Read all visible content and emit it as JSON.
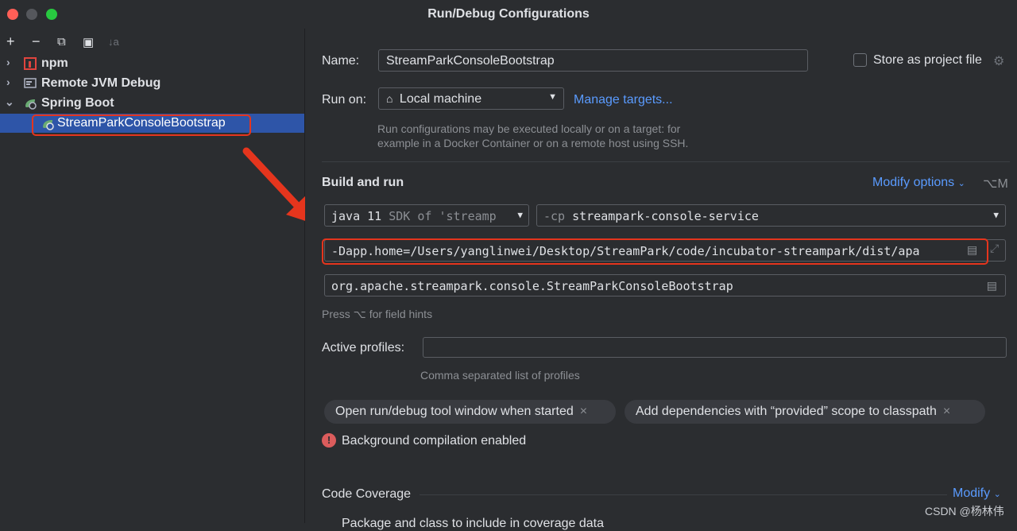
{
  "window": {
    "title": "Run/Debug Configurations"
  },
  "toolbar": {
    "add": "+",
    "remove": "−",
    "copy": "⧉",
    "folder": "▣",
    "sort": "↓a"
  },
  "tree": {
    "npm": "npm",
    "remote": "Remote JVM Debug",
    "spring": "Spring Boot",
    "selected": "StreamParkConsoleBootstrap"
  },
  "form": {
    "name_label": "Name:",
    "name_value": "StreamParkConsoleBootstrap",
    "store_label": "Store as project file",
    "runon_label": "Run on:",
    "runon_value": "Local machine",
    "manage_targets": "Manage targets...",
    "runon_hint_1": "Run configurations may be executed locally or on a target: for",
    "runon_hint_2": "example in a Docker Container or on a remote host using SSH.",
    "build_run": "Build and run",
    "modify_options": "Modify options",
    "modify_shortcut": "⌥M",
    "jdk_value": "java 11",
    "jdk_suffix": "SDK of 'streamp",
    "cp_prefix": "-cp",
    "cp_value": "streampark-console-service",
    "vm_options": "-Dapp.home=/Users/yanglinwei/Desktop/StreamPark/code/incubator-streampark/dist/apa",
    "main_class": "org.apache.streampark.console.StreamParkConsoleBootstrap",
    "field_hints": "Press ⌥ for field hints",
    "profiles_label": "Active profiles:",
    "profiles_hint": "Comma separated list of profiles",
    "chip1": "Open run/debug tool window when started",
    "chip2": "Add dependencies with “provided” scope to classpath",
    "chip_close": "×",
    "bg_compile": "Background compilation enabled",
    "code_coverage": "Code Coverage",
    "modify": "Modify",
    "bottom_partial": "Package and class to include in coverage data",
    "watermark": "CSDN @杨林伟"
  },
  "colors": {
    "accent": "#2e55a8",
    "link": "#5a9bff",
    "highlight": "#e5351d"
  }
}
